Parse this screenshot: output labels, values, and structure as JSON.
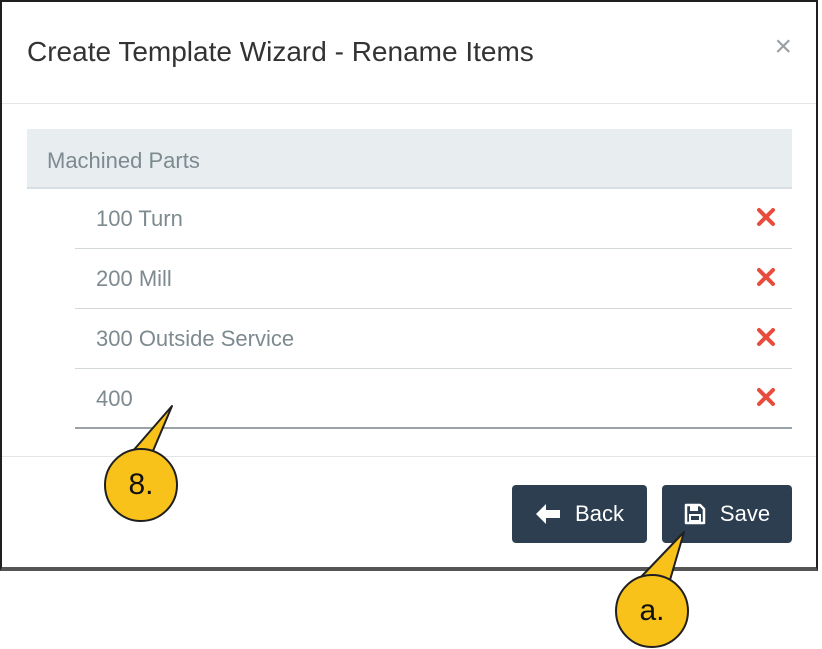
{
  "dialog": {
    "title": "Create Template Wizard - Rename Items",
    "close_label": "×"
  },
  "group": {
    "label": "Machined Parts"
  },
  "items": [
    {
      "value": "100 Turn"
    },
    {
      "value": "200 Mill"
    },
    {
      "value": "300 Outside Service"
    },
    {
      "value": "400"
    }
  ],
  "footer": {
    "back_label": "Back",
    "save_label": "Save"
  },
  "callouts": {
    "step_label": "8.",
    "sub_label": "a."
  },
  "colors": {
    "primary_button": "#2c3e50",
    "remove_icon": "#e74c3c",
    "callout_fill": "#f9c21b",
    "group_header_bg": "#e8eef0"
  },
  "icons": {
    "close": "close-icon",
    "remove": "remove-icon",
    "back": "arrow-left-icon",
    "save": "floppy-disk-icon"
  }
}
